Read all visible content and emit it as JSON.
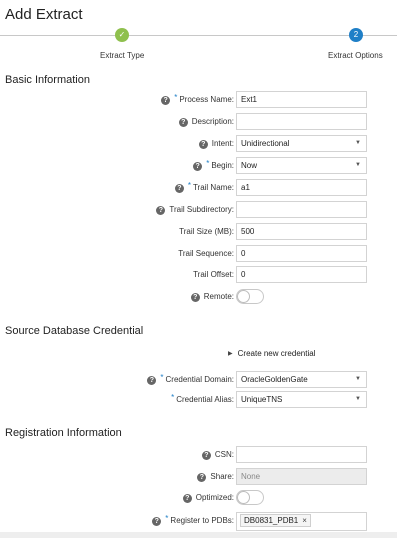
{
  "page": {
    "title": "Add Extract"
  },
  "stepper": {
    "steps": [
      {
        "label": "Extract Type",
        "state": "done",
        "glyph": "✓"
      },
      {
        "label": "Extract Options",
        "state": "active",
        "glyph": "2"
      }
    ],
    "colors": {
      "done": "#8fc04e",
      "active": "#1f7fc7"
    }
  },
  "basic": {
    "title": "Basic Information",
    "process_name": {
      "label": "Process Name:",
      "value": "Ext1",
      "required": true,
      "help": true
    },
    "description": {
      "label": "Description:",
      "value": "",
      "help": true
    },
    "intent": {
      "label": "Intent:",
      "value": "Unidirectional",
      "help": true
    },
    "begin": {
      "label": "Begin:",
      "value": "Now",
      "required": true,
      "help": true
    },
    "trail_name": {
      "label": "Trail Name:",
      "value": "a1",
      "required": true,
      "help": true
    },
    "trail_subdirectory": {
      "label": "Trail Subdirectory:",
      "value": "",
      "help": true
    },
    "trail_size": {
      "label": "Trail Size (MB):",
      "value": "500"
    },
    "trail_sequence": {
      "label": "Trail Sequence:",
      "value": "0"
    },
    "trail_offset": {
      "label": "Trail Offset:",
      "value": "0"
    },
    "remote": {
      "label": "Remote:",
      "value": false,
      "help": true
    }
  },
  "source": {
    "title": "Source Database Credential",
    "create_link": "Create new credential",
    "credential_domain": {
      "label": "Credential Domain:",
      "value": "OracleGoldenGate",
      "required": true,
      "help": true
    },
    "credential_alias": {
      "label": "Credential Alias:",
      "value": "UniqueTNS",
      "required": true
    }
  },
  "registration": {
    "title": "Registration Information",
    "csn": {
      "label": "CSN:",
      "value": "",
      "help": true
    },
    "share": {
      "label": "Share:",
      "value": "None",
      "help": true
    },
    "optimized": {
      "label": "Optimized:",
      "value": false,
      "help": true
    },
    "register_pdbs": {
      "label": "Register to PDBs:",
      "chip": "DB0831_PDB1",
      "required": true,
      "help": true
    }
  },
  "glyphs": {
    "help": "?",
    "required": "*",
    "caret": "▼",
    "expand": "▶",
    "remove": "×"
  }
}
